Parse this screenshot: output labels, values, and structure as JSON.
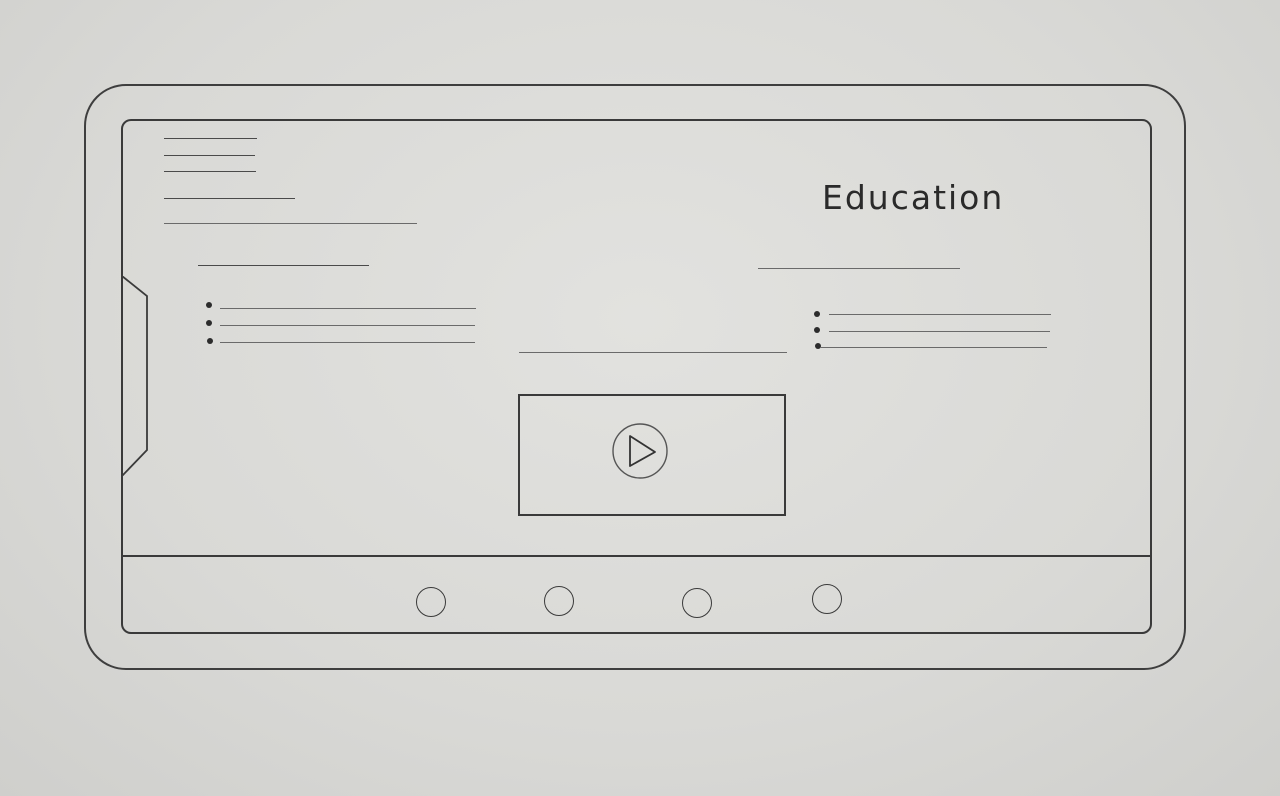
{
  "header": {
    "brand_title": "Education"
  },
  "video": {
    "play_icon": "play-icon"
  },
  "bottom_nav": {
    "items": [
      {
        "icon": "nav-circle-icon"
      },
      {
        "icon": "nav-circle-icon"
      },
      {
        "icon": "nav-circle-icon"
      },
      {
        "icon": "nav-circle-icon"
      }
    ]
  },
  "colors": {
    "paper": "#dcdcd9",
    "ink": "#3a3a3a"
  }
}
